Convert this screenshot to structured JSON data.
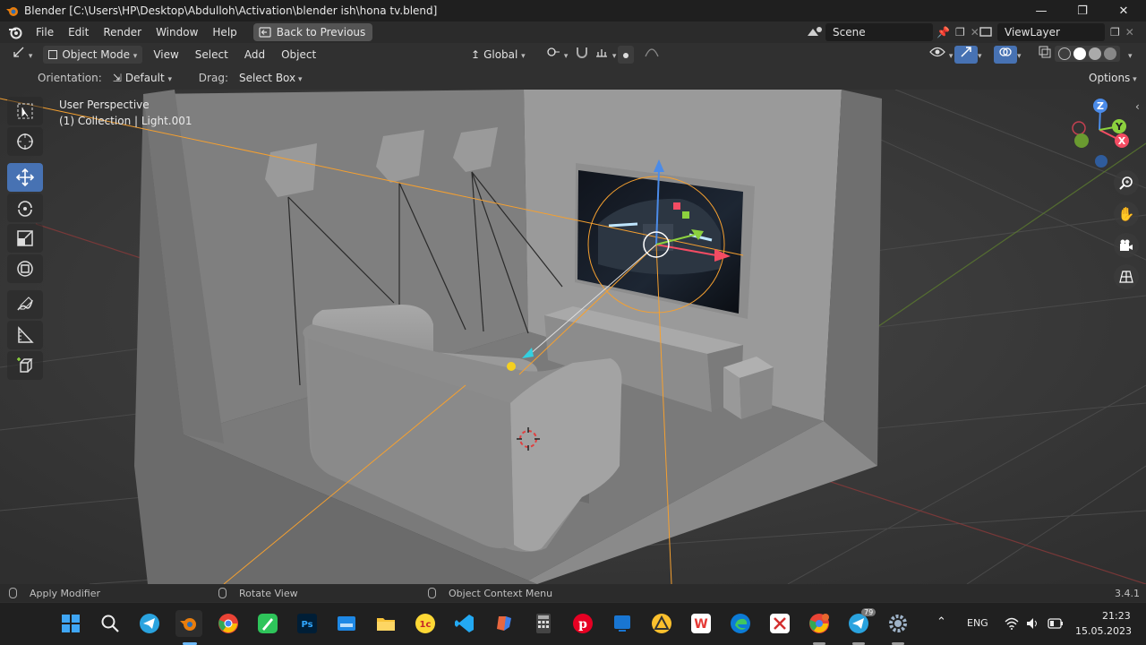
{
  "titlebar": {
    "title": "Blender [C:\\Users\\HP\\Desktop\\Abdulloh\\Activation\\blender ish\\hona tv.blend]",
    "minimize": "—",
    "maximize": "❐",
    "close": "✕"
  },
  "menubar": {
    "items": [
      "File",
      "Edit",
      "Render",
      "Window",
      "Help"
    ],
    "back_button": "Back to Previous",
    "scene_label": "Scene",
    "viewlayer_label": "ViewLayer"
  },
  "viewport_header": {
    "mode": "Object Mode",
    "menus": [
      "View",
      "Select",
      "Add",
      "Object"
    ],
    "transform_orientation": "Global"
  },
  "tool_settings": {
    "orientation_label": "Orientation:",
    "orientation_value": "Default",
    "drag_label": "Drag:",
    "drag_value": "Select Box",
    "options_label": "Options"
  },
  "viewport": {
    "perspective": "User Perspective",
    "collection": "(1) Collection | Light.001",
    "gizmo_labels": {
      "z": "Z",
      "y": "Y",
      "x": "X"
    }
  },
  "statusbar": {
    "left": "Apply Modifier",
    "middle": "Rotate View",
    "right": "Object Context Menu",
    "version": "3.4.1"
  },
  "taskbar": {
    "language": "ENG",
    "time": "21:23",
    "date": "15.05.2023",
    "telegram_badge": "79",
    "apps": [
      "start",
      "search",
      "telegram",
      "blender",
      "chrome",
      "word-like",
      "photoshop",
      "keyboard",
      "explorer",
      "1c",
      "vscode",
      "copilot",
      "calculator",
      "pinterest",
      "screen",
      "warning",
      "wps",
      "edge",
      "video",
      "chrome-profile",
      "telegram-2",
      "settings"
    ]
  },
  "colors": {
    "accent_blue": "#4772b3",
    "axis_x": "#f44c63",
    "axis_y": "#8cd13e",
    "axis_z": "#4b8be8",
    "light_orange": "#f5a030"
  }
}
